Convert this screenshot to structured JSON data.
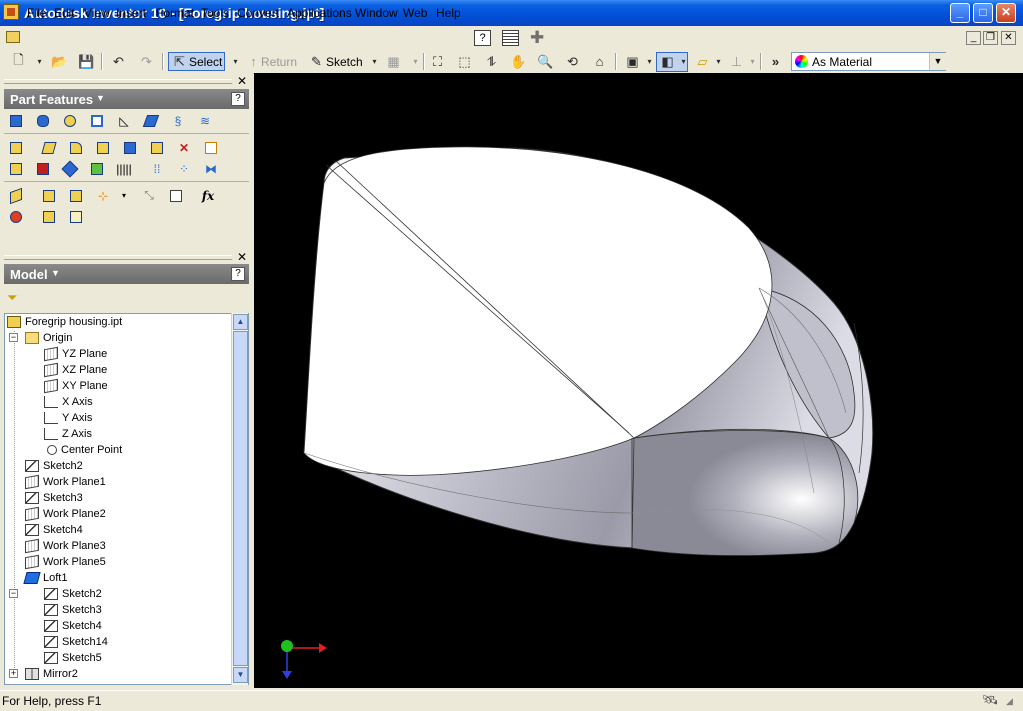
{
  "window": {
    "title": "Autodesk Inventor 10 - [Foregrip housing.ipt]"
  },
  "menu": [
    "File",
    "Edit",
    "View",
    "Insert",
    "Format",
    "Tools",
    "Convert",
    "Applications",
    "Window",
    "Web",
    "Help"
  ],
  "toolbar": {
    "select_label": "Select",
    "return_label": "Return",
    "sketch_label": "Sketch",
    "appearance_value": "As Material"
  },
  "part_features": {
    "title": "Part Features"
  },
  "model": {
    "title": "Model",
    "tree": [
      {
        "label": "Foregrip housing.ipt",
        "icon": "part-icon"
      },
      {
        "label": "Origin",
        "icon": "folder-icon"
      },
      {
        "label": "YZ Plane",
        "icon": "plane-icon"
      },
      {
        "label": "XZ Plane",
        "icon": "plane-icon"
      },
      {
        "label": "XY Plane",
        "icon": "plane-icon"
      },
      {
        "label": "X Axis",
        "icon": "axis-icon"
      },
      {
        "label": "Y Axis",
        "icon": "axis-icon"
      },
      {
        "label": "Z Axis",
        "icon": "axis-icon"
      },
      {
        "label": "Center Point",
        "icon": "point-icon"
      },
      {
        "label": "Sketch2",
        "icon": "sketch-icon"
      },
      {
        "label": "Work Plane1",
        "icon": "plane-icon"
      },
      {
        "label": "Sketch3",
        "icon": "sketch-icon"
      },
      {
        "label": "Work Plane2",
        "icon": "plane-icon"
      },
      {
        "label": "Sketch4",
        "icon": "sketch-icon"
      },
      {
        "label": "Work Plane3",
        "icon": "plane-icon"
      },
      {
        "label": "Work Plane5",
        "icon": "plane-icon"
      },
      {
        "label": "Loft1",
        "icon": "loft-icon"
      },
      {
        "label": "Sketch2",
        "icon": "sketch-icon"
      },
      {
        "label": "Sketch3",
        "icon": "sketch-icon"
      },
      {
        "label": "Sketch4",
        "icon": "sketch-icon"
      },
      {
        "label": "Sketch14",
        "icon": "sketch-icon"
      },
      {
        "label": "Sketch5",
        "icon": "sketch-icon"
      },
      {
        "label": "Mirror2",
        "icon": "mirror-icon"
      }
    ]
  },
  "status": {
    "text": "For Help, press F1"
  }
}
